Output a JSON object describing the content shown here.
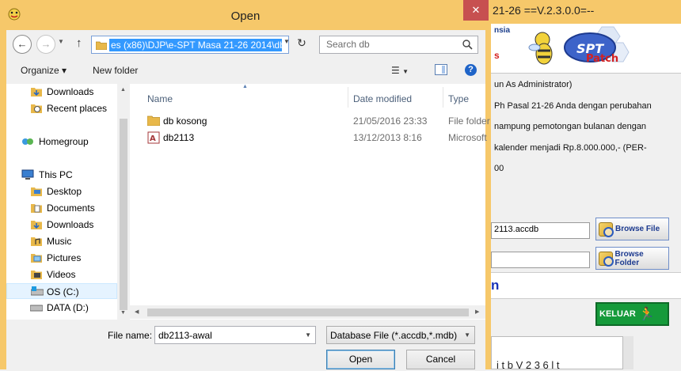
{
  "background_app": {
    "title": "21-26 ==V.2.3.0.0=--",
    "header_line1": "nsia",
    "header_line2": "s",
    "logo_text": "Patch",
    "logo_letters": "SPT",
    "desc_lines": [
      "un As Administrator)",
      "Ph Pasal 21-26 Anda dengan perubahan",
      "nampung pemotongan bulanan dengan",
      "kalender menjadi Rp.8.000.000,- (PER-",
      "00"
    ],
    "file_field_value": "2113.accdb",
    "folder_field_value": "",
    "browse_file_label": "Browse File",
    "browse_folder_label": "Browse Folder",
    "bar_text": "n",
    "keluar_label": "KELUAR",
    "bottom_text": "i t   b          V 2 3 6   l t"
  },
  "dialog": {
    "title": "Open",
    "close_label": "✕",
    "address_path": "es (x86)\\DJP\\e-SPT Masa 21-26 2014\\db",
    "search_placeholder": "Search db",
    "toolbar": {
      "organize_label": "Organize ▾",
      "new_folder_label": "New folder"
    },
    "nav": [
      {
        "label": "Downloads",
        "icon": "downloads-folder-icon"
      },
      {
        "label": "Recent places",
        "icon": "recent-places-icon"
      },
      {
        "label": "Homegroup",
        "icon": "homegroup-icon"
      },
      {
        "label": "This PC",
        "icon": "computer-icon"
      },
      {
        "label": "Desktop",
        "icon": "desktop-folder-icon"
      },
      {
        "label": "Documents",
        "icon": "documents-folder-icon"
      },
      {
        "label": "Downloads",
        "icon": "downloads-folder-icon"
      },
      {
        "label": "Music",
        "icon": "music-folder-icon"
      },
      {
        "label": "Pictures",
        "icon": "pictures-folder-icon"
      },
      {
        "label": "Videos",
        "icon": "videos-folder-icon"
      },
      {
        "label": "OS (C:)",
        "icon": "drive-c-icon"
      },
      {
        "label": "DATA (D:)",
        "icon": "drive-icon"
      }
    ],
    "columns": {
      "name": "Name",
      "date_modified": "Date modified",
      "type": "Type"
    },
    "files": [
      {
        "name": "db kosong",
        "date": "21/05/2016 23:33",
        "type": "File folder",
        "icon": "folder-icon"
      },
      {
        "name": "db2113",
        "date": "13/12/2013 8:16",
        "type": "Microsoft",
        "icon": "access-database-icon"
      }
    ],
    "file_name_label": "File name:",
    "file_name_value": "db2113-awal",
    "file_type_value": "Database File (*.accdb,*.mdb)",
    "open_label": "Open",
    "cancel_label": "Cancel"
  },
  "colors": {
    "dialog_frame": "#f6c86a",
    "selection": "#3399ff",
    "close_button": "#c75050",
    "keluar_button": "#159a3a"
  }
}
